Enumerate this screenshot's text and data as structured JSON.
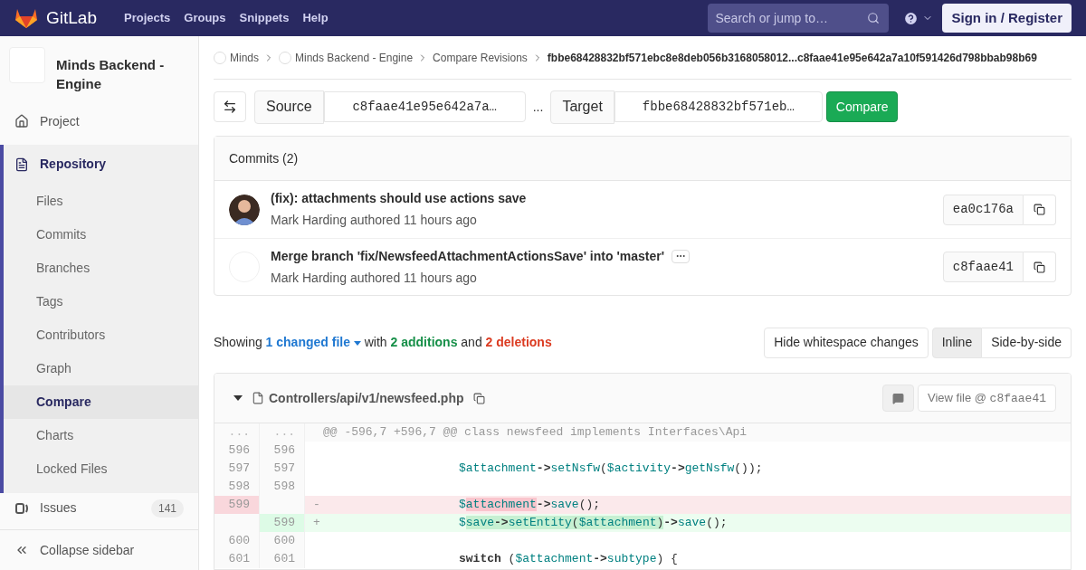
{
  "topbar": {
    "logo": "GitLab",
    "links": [
      "Projects",
      "Groups",
      "Snippets",
      "Help"
    ],
    "search": {
      "placeholder": "Search or jump to…"
    },
    "sign_in": "Sign in / Register"
  },
  "sidebar": {
    "project": "Minds Backend - Engine",
    "items": [
      {
        "label": "Project",
        "selected": false
      },
      {
        "label": "Repository",
        "selected": true,
        "children": [
          {
            "label": "Files",
            "selected": false
          },
          {
            "label": "Commits",
            "selected": false
          },
          {
            "label": "Branches",
            "selected": false
          },
          {
            "label": "Tags",
            "selected": false
          },
          {
            "label": "Contributors",
            "selected": false
          },
          {
            "label": "Graph",
            "selected": false
          },
          {
            "label": "Compare",
            "selected": true
          },
          {
            "label": "Charts",
            "selected": false
          },
          {
            "label": "Locked Files",
            "selected": false
          }
        ]
      },
      {
        "label": "Issues",
        "selected": false,
        "count": "141"
      }
    ],
    "collapse": "Collapse sidebar"
  },
  "breadcrumbs": [
    {
      "label": "Minds",
      "avatar": true,
      "current": false
    },
    {
      "label": "Minds Backend - Engine",
      "avatar": true,
      "current": false
    },
    {
      "label": "Compare Revisions",
      "avatar": false,
      "current": false
    },
    {
      "label": "fbbe68428832bf571ebc8e8deb056b3168058012...c8faae41e95e642a7a10f591426d798bbab98b69",
      "avatar": false,
      "current": true
    }
  ],
  "compare": {
    "source_label": "Source",
    "source": "c8faae41e95e642a7a…",
    "separator": "...",
    "target_label": "Target",
    "target": "fbbe68428832bf571eb…",
    "button": "Compare"
  },
  "commits": {
    "title": "Commits (2)",
    "items": [
      {
        "title": "(fix): attachments should use actions save",
        "meta": "Mark Harding authored 11 hours ago",
        "sha": "ea0c176a",
        "avatar": true,
        "more": false
      },
      {
        "title": "Merge branch 'fix/NewsfeedAttachmentActionsSave' into 'master'",
        "meta": "Mark Harding authored 11 hours ago",
        "sha": "c8faae41",
        "avatar": false,
        "more": true
      }
    ]
  },
  "summary": {
    "showing": "Showing",
    "files": "1 changed file",
    "with": "with",
    "additions": "2 additions",
    "and": "and",
    "deletions": "2 deletions"
  },
  "view_options": {
    "whitespace": "Hide whitespace changes",
    "modes": [
      {
        "label": "Inline",
        "selected": true
      },
      {
        "label": "Side-by-side",
        "selected": false
      }
    ]
  },
  "file": {
    "path": "Controllers/api/v1/newsfeed.php",
    "view_label": "View file @ ",
    "view_sha": "c8faae41",
    "lines": [
      {
        "kind": "hunk",
        "old": "...",
        "new": "...",
        "text": "@@ -596,7 +596,7 @@ class newsfeed implements Interfaces\\Api"
      },
      {
        "kind": "context",
        "old": "596",
        "new": "596"
      },
      {
        "kind": "context",
        "old": "597",
        "new": "597",
        "tokens": [
          {
            "t": "$attachment",
            "kind": "var",
            "hl": false
          },
          {
            "t": "->",
            "kind": "op",
            "hl": false
          },
          {
            "t": "setNsfw",
            "kind": "fn",
            "hl": false
          },
          {
            "t": "(",
            "kind": "plain",
            "hl": false
          },
          {
            "t": "$activity",
            "kind": "var",
            "hl": false
          },
          {
            "t": "->",
            "kind": "op",
            "hl": false
          },
          {
            "t": "getNsfw",
            "kind": "fn",
            "hl": false
          },
          {
            "t": "());",
            "kind": "plain",
            "hl": false
          }
        ]
      },
      {
        "kind": "context",
        "old": "598",
        "new": "598"
      },
      {
        "kind": "del",
        "old": "599",
        "sign": "-",
        "tokens": [
          {
            "t": "$",
            "kind": "var",
            "hl": false
          },
          {
            "t": "attachment",
            "kind": "var",
            "hl": true
          },
          {
            "t": "->",
            "kind": "op",
            "hl": false
          },
          {
            "t": "save",
            "kind": "fn",
            "hl": false
          },
          {
            "t": "();",
            "kind": "plain",
            "hl": false
          }
        ]
      },
      {
        "kind": "add",
        "new": "599",
        "sign": "+",
        "tokens": [
          {
            "t": "$",
            "kind": "var",
            "hl": false
          },
          {
            "t": "save",
            "kind": "var",
            "hl": true
          },
          {
            "t": "->",
            "kind": "op",
            "hl": true
          },
          {
            "t": "setEntity",
            "kind": "fn",
            "hl": true
          },
          {
            "t": "(",
            "kind": "plain",
            "hl": true
          },
          {
            "t": "$attachment",
            "kind": "var",
            "hl": true
          },
          {
            "t": ")",
            "kind": "plain",
            "hl": true
          },
          {
            "t": "->",
            "kind": "op",
            "hl": false
          },
          {
            "t": "save",
            "kind": "fn",
            "hl": false
          },
          {
            "t": "();",
            "kind": "plain",
            "hl": false
          }
        ]
      },
      {
        "kind": "context",
        "old": "600",
        "new": "600"
      },
      {
        "kind": "context",
        "old": "601",
        "new": "601",
        "tokens": [
          {
            "t": "switch",
            "kind": "kw",
            "hl": false
          },
          {
            "t": " (",
            "kind": "plain",
            "hl": false
          },
          {
            "t": "$attachment",
            "kind": "var",
            "hl": false
          },
          {
            "t": "->",
            "kind": "op",
            "hl": false
          },
          {
            "t": "subtype",
            "kind": "fn",
            "hl": false
          },
          {
            "t": ") {",
            "kind": "plain",
            "hl": false
          }
        ]
      }
    ]
  }
}
